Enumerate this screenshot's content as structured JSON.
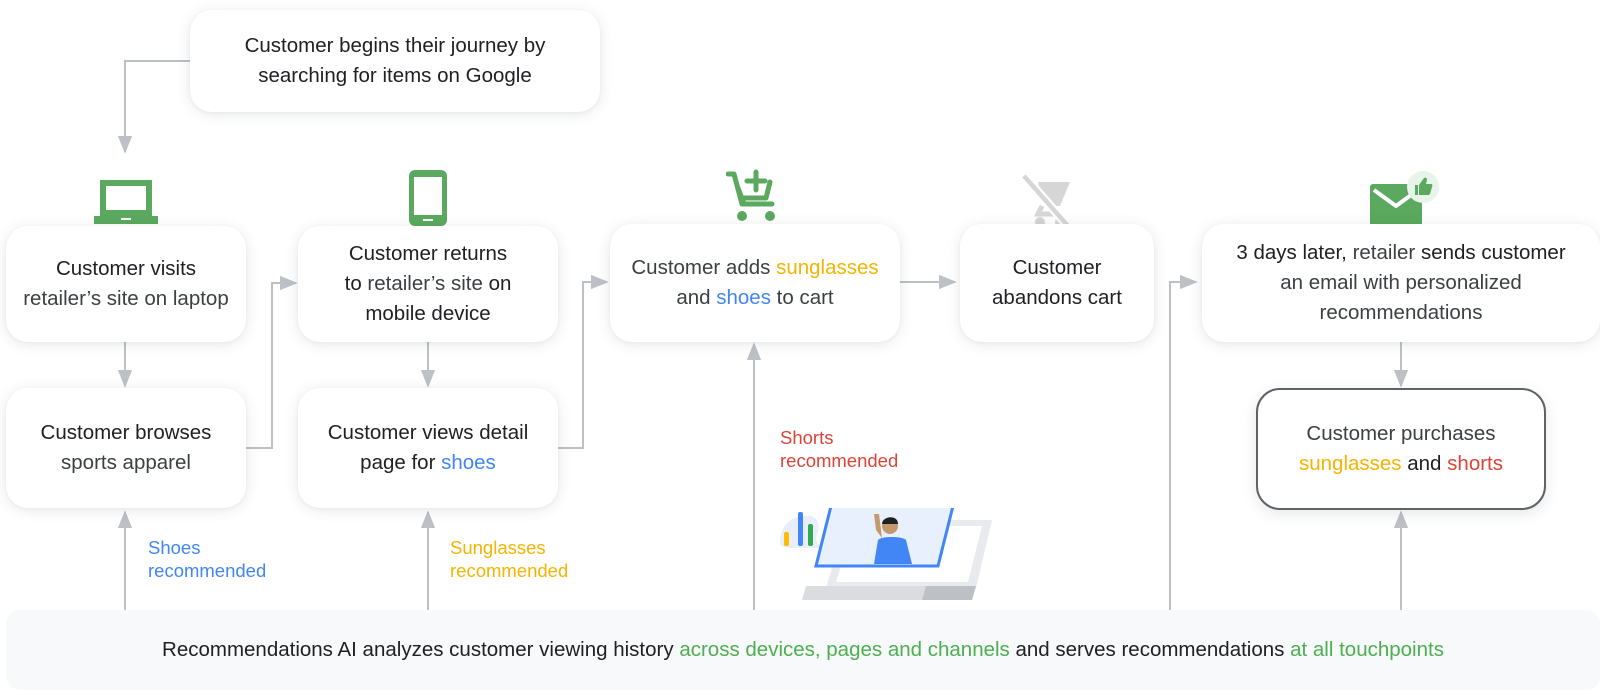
{
  "colors": {
    "green": "#5aa95e",
    "blue": "#4285f4",
    "yellow": "#f4b400",
    "red": "#db4437",
    "connector": "#bdc1c6",
    "disabled_icon": "#d0d0d0"
  },
  "start": {
    "line1": "Customer begins their journey by",
    "line2": "searching for items on Google"
  },
  "steps": {
    "visit_laptop": {
      "icon": "laptop-icon",
      "line1": "Customer visits",
      "line2": "retailer’s site on laptop"
    },
    "browses": {
      "line1": "Customer browses",
      "line2": "sports apparel"
    },
    "returns_mobile": {
      "icon": "smartphone-icon",
      "line1": "Customer returns",
      "line2_a": "to ",
      "line2_b": "retailer’s site",
      "line2_c": " on",
      "line3": "mobile device"
    },
    "views_detail": {
      "line1": "Customer views detail",
      "line2_a": "page for ",
      "line2_b": "shoes"
    },
    "adds_cart": {
      "icon": "add-to-cart-icon",
      "line1_a": "Customer adds ",
      "line1_b": "sunglasses",
      "line2_a": "and ",
      "line2_b": "shoes",
      "line2_c": " to cart"
    },
    "abandons": {
      "icon": "remove-shopping-cart-icon",
      "line1": "Customer",
      "line2": "abandons cart"
    },
    "email": {
      "icon": "email-thumbs-up-icon",
      "line1_a": "3 days later, ",
      "line1_b": "retailer",
      "line1_c": " sends customer",
      "line2": "an email with personalized",
      "line3": "recommendations"
    },
    "purchase": {
      "line1": "Customer purchases",
      "line2_a": "sunglasses",
      "line2_b": " and ",
      "line2_c": "shorts"
    }
  },
  "recommendations": {
    "shoes": {
      "line1": "Shoes",
      "line2": "recommended"
    },
    "sunglasses": {
      "line1": "Sunglasses",
      "line2": "recommended"
    },
    "shorts": {
      "line1": "Shorts",
      "line2": "recommended"
    }
  },
  "illustration": "person-on-laptop-video-call-illustration",
  "footer": {
    "part1": "Recommendations AI analyzes customer viewing history ",
    "part2": "across devices, pages and channels",
    "part3": " and serves recommendations ",
    "part4": "at all touchpoints"
  }
}
